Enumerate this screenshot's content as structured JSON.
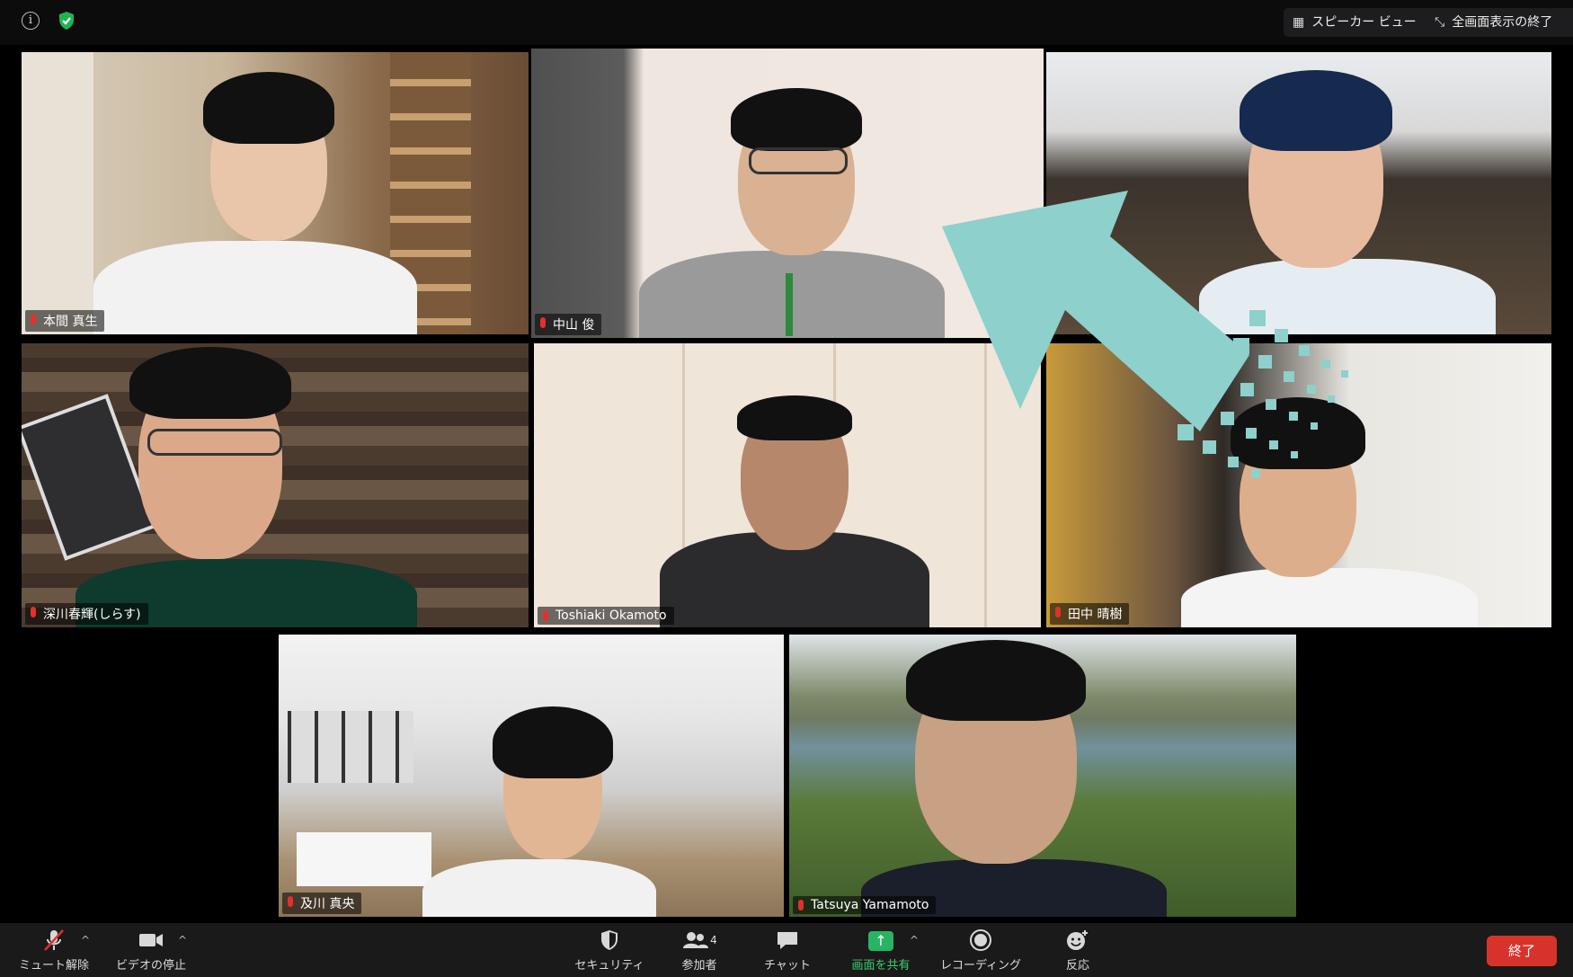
{
  "top_bar": {
    "info_icon": "info-icon",
    "encryption_icon": "shield-check-icon",
    "speaker_view_label": "スピーカー ビュー",
    "exit_fullscreen_label": "全画面表示の終了"
  },
  "participants": [
    {
      "name": "本間 真生",
      "active": false
    },
    {
      "name": "中山 俊",
      "active": true
    },
    {
      "name": "",
      "active": false
    },
    {
      "name": "深川春輝(しらす)",
      "active": false
    },
    {
      "name": "Toshiaki Okamoto",
      "active": false
    },
    {
      "name": "田中 晴樹",
      "active": false
    },
    {
      "name": "及川 真央",
      "active": false
    },
    {
      "name": "Tatsuya Yamamoto",
      "active": false
    }
  ],
  "toolbar": {
    "unmute_label": "ミュート解除",
    "stop_video_label": "ビデオの停止",
    "security_label": "セキュリティ",
    "participants_label": "参加者",
    "participants_count": "4",
    "chat_label": "チャット",
    "share_screen_label": "画面を共有",
    "record_label": "レコーディング",
    "reactions_label": "反応",
    "end_label": "終了"
  },
  "colors": {
    "active_speaker_border": "#c8e66e",
    "share_green": "#28b463",
    "end_red": "#d8332b",
    "arrow_teal": "#8dd0cc"
  }
}
